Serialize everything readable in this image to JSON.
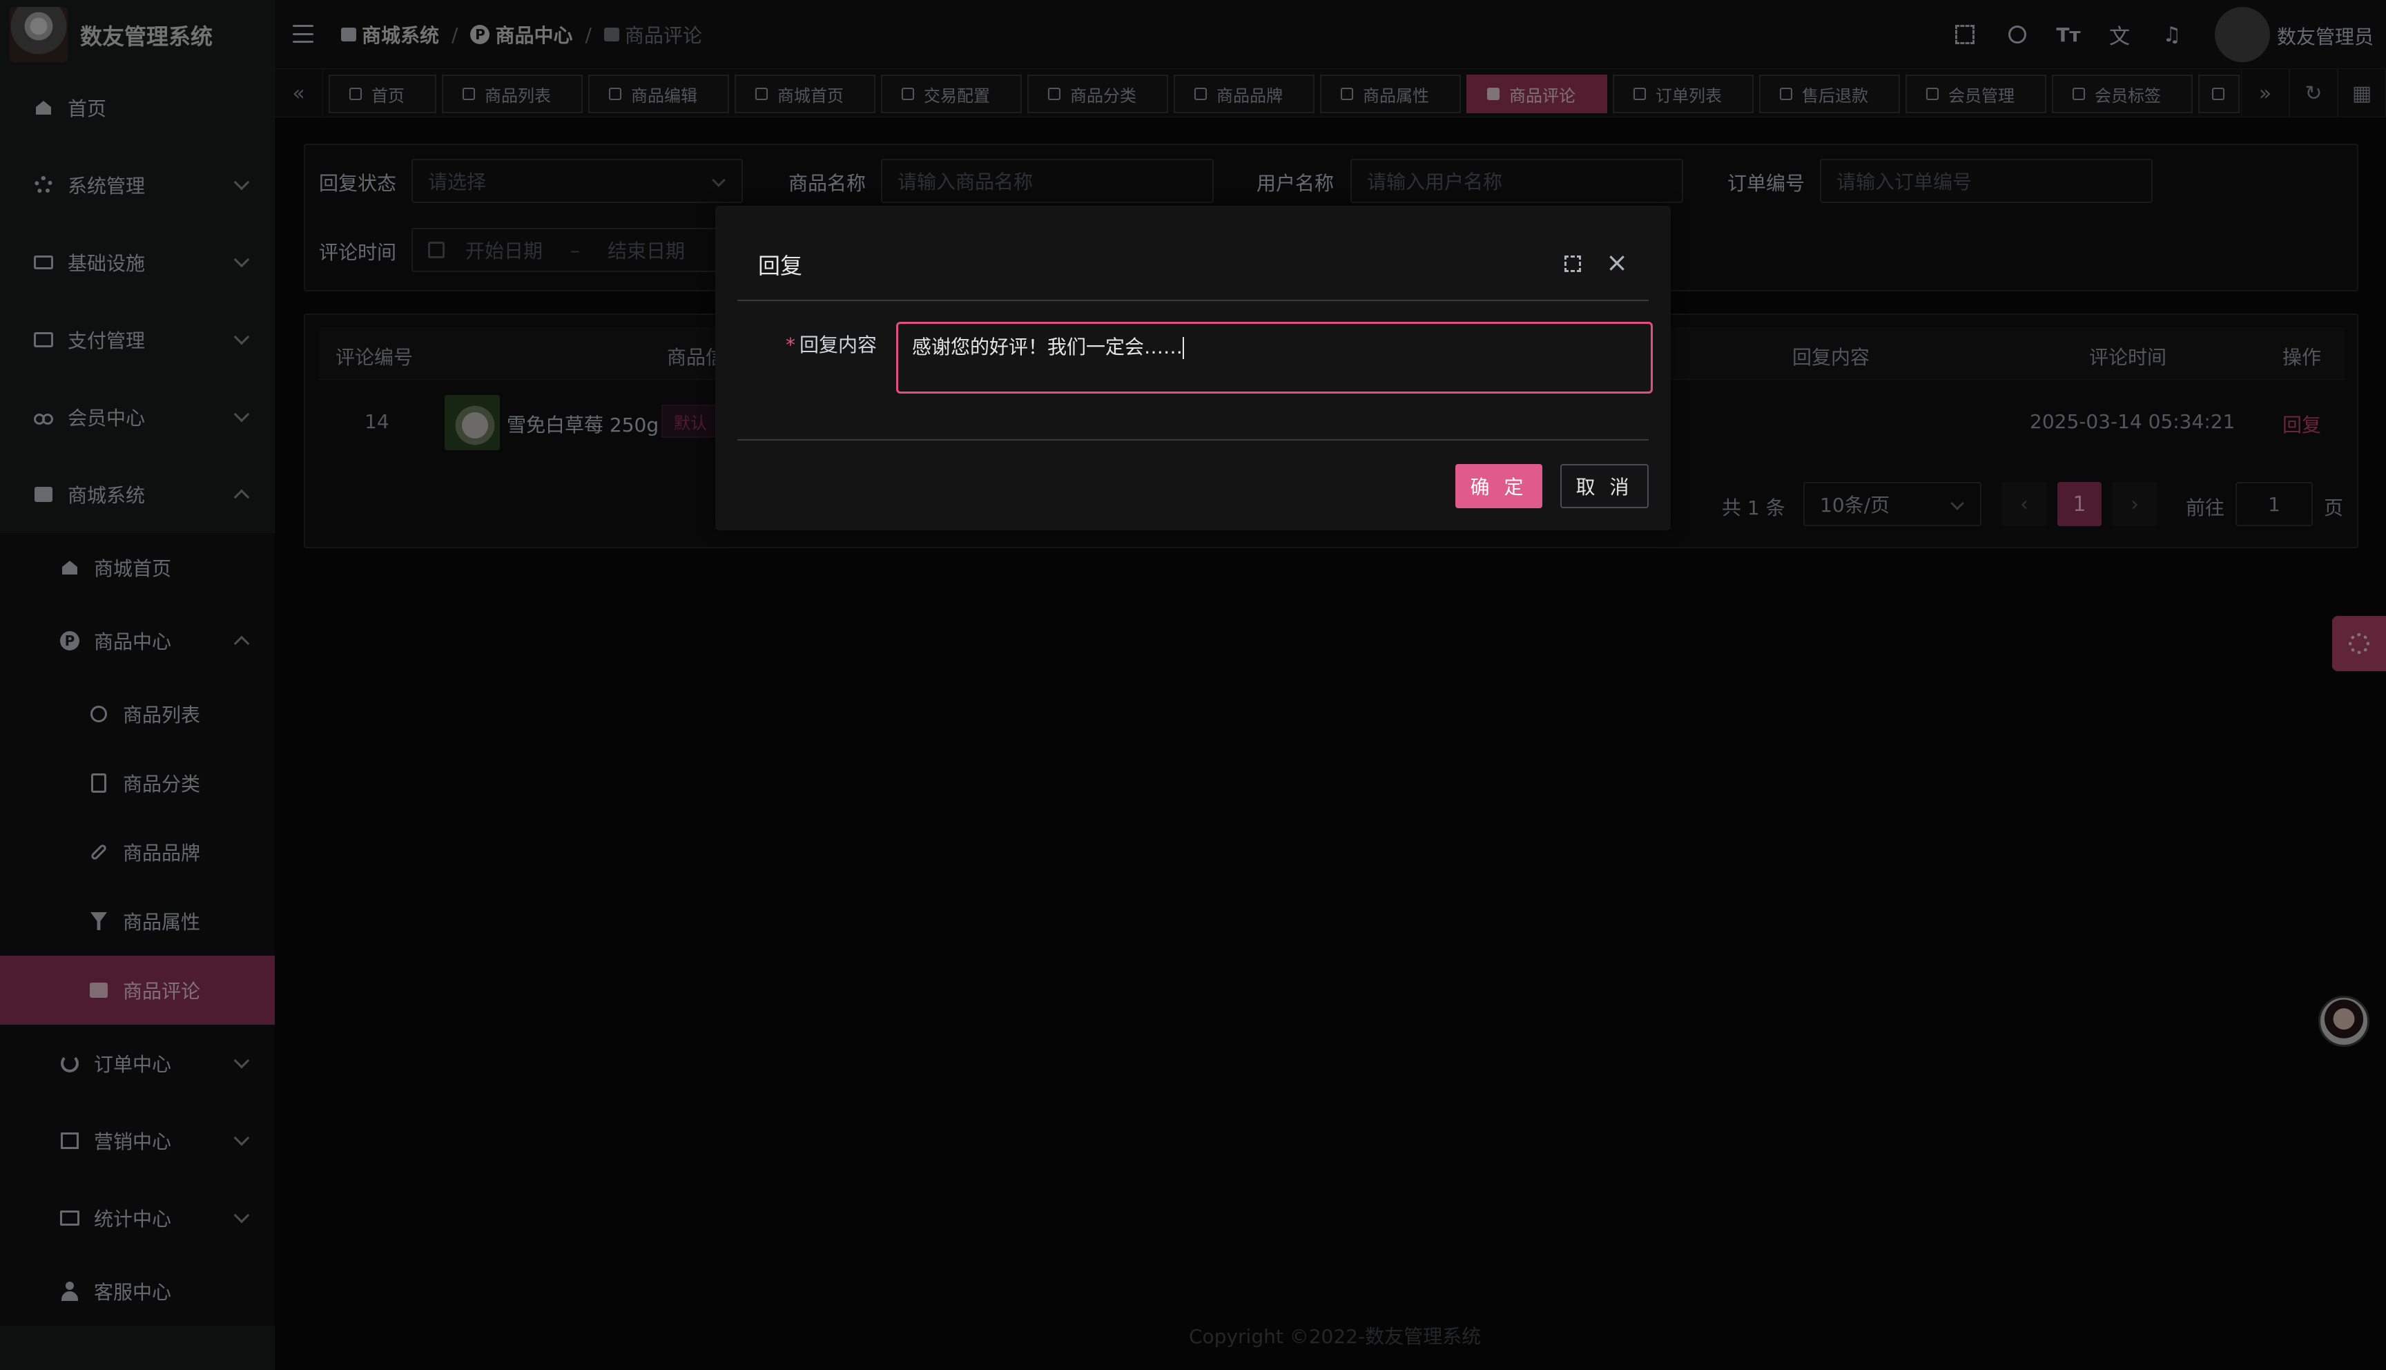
{
  "app": {
    "title": "数友管理系统"
  },
  "sidebar": {
    "items": [
      {
        "label": "首页",
        "icon": "home-icon"
      },
      {
        "label": "系统管理",
        "icon": "gear-icon"
      },
      {
        "label": "基础设施",
        "icon": "monitor-icon"
      },
      {
        "label": "支付管理",
        "icon": "card-icon"
      },
      {
        "label": "会员中心",
        "icon": "share-icon"
      },
      {
        "label": "商城系统",
        "icon": "shop-icon"
      },
      {
        "label": "商城首页",
        "icon": "home-icon"
      },
      {
        "label": "商品中心",
        "icon": "p-icon"
      },
      {
        "label": "商品列表",
        "icon": "apple-icon"
      },
      {
        "label": "商品分类",
        "icon": "doc-icon"
      },
      {
        "label": "商品品牌",
        "icon": "link-icon"
      },
      {
        "label": "商品属性",
        "icon": "filter-icon"
      },
      {
        "label": "商品评论",
        "icon": "chat-icon"
      },
      {
        "label": "订单中心",
        "icon": "chart-icon"
      },
      {
        "label": "营销中心",
        "icon": "gift-icon"
      },
      {
        "label": "统计中心",
        "icon": "board-icon"
      },
      {
        "label": "客服中心",
        "icon": "user-icon"
      }
    ]
  },
  "header": {
    "breadcrumb": [
      "商城系统",
      "商品中心",
      "商品评论"
    ],
    "breadcrumb_sep": "/",
    "username": "数友管理员"
  },
  "tabs": [
    "首页",
    "商品列表",
    "商品编辑",
    "商城首页",
    "交易配置",
    "商品分类",
    "商品品牌",
    "商品属性",
    "商品评论",
    "订单列表",
    "售后退款",
    "会员管理",
    "会员标签"
  ],
  "search": {
    "reply_status_label": "回复状态",
    "reply_status_placeholder": "请选择",
    "product_name_label": "商品名称",
    "product_name_placeholder": "请输入商品名称",
    "user_name_label": "用户名称",
    "user_name_placeholder": "请输入用户名称",
    "order_no_label": "订单编号",
    "order_no_placeholder": "请输入订单编号",
    "comment_time_label": "评论时间",
    "start_date_placeholder": "开始日期",
    "date_sep": "–",
    "end_date_placeholder": "结束日期"
  },
  "table": {
    "headers": {
      "id": "评论编号",
      "product": "商品信",
      "reply": "回复内容",
      "time": "评论时间",
      "action": "操作"
    },
    "rows": [
      {
        "id": "14",
        "product": "雪免白草莓 250g",
        "tag": "默认",
        "time": "2025-03-14 05:34:21",
        "action": "回复"
      }
    ]
  },
  "pagination": {
    "total": "共 1 条",
    "page_size": "10条/页",
    "prev": "‹",
    "current": "1",
    "next": "›",
    "goto_label": "前往",
    "goto_value": "1",
    "page_suffix": "页"
  },
  "footer": {
    "copyright": "Copyright ©2022-数友管理系统"
  },
  "dialog": {
    "title": "回复",
    "field_label": "回复内容",
    "required_mark": "*",
    "content": "感谢您的好评！我们一定会……",
    "ok_label": "确 定",
    "cancel_label": "取 消",
    "close_glyph": "×"
  },
  "colors": {
    "accent": "#e05a8a",
    "active_menu": "#9b3b5f",
    "background": "#0a0a0a"
  }
}
